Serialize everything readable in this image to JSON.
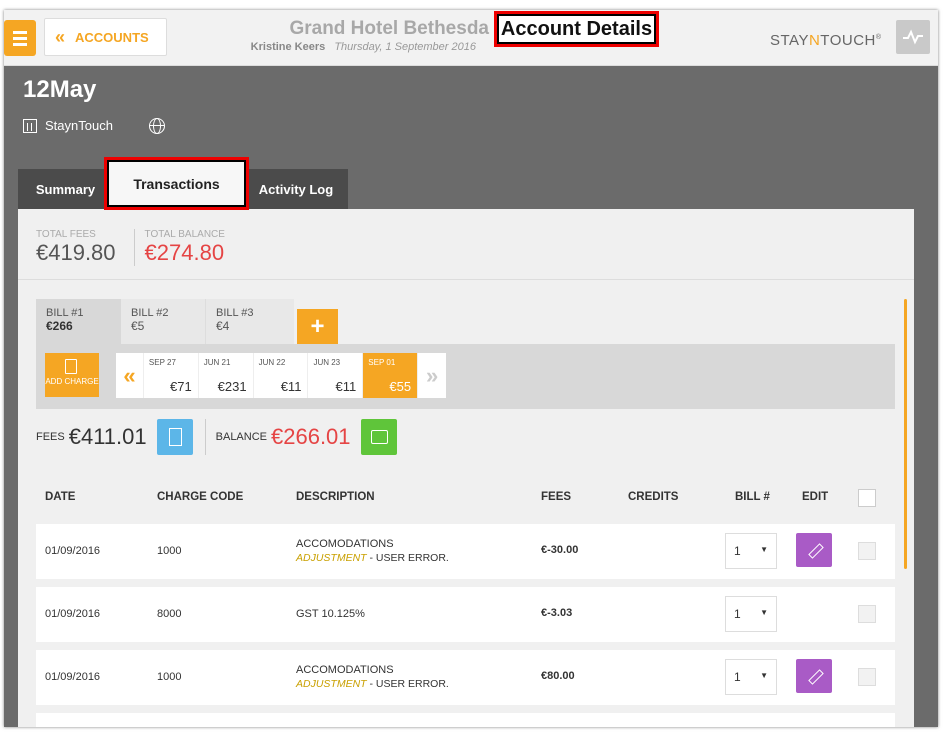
{
  "header": {
    "back_label": "ACCOUNTS",
    "hotel_name": "Grand Hotel Bethesda",
    "user_name": "Kristine Keers",
    "date": "Thursday, 1 September 2016",
    "page_title": "Account Details",
    "logo_left": "STAY",
    "logo_n": "N",
    "logo_right": "TOUCH",
    "logo_mark": "®"
  },
  "account": {
    "name": "12May",
    "company": "StaynTouch"
  },
  "tabs": [
    {
      "label": "Summary"
    },
    {
      "label": "Transactions"
    },
    {
      "label": "Activity Log"
    }
  ],
  "totals": {
    "fees_label": "TOTAL FEES",
    "fees_value": "€419.80",
    "balance_label": "TOTAL BALANCE",
    "balance_value": "€274.80"
  },
  "bills": [
    {
      "label": "BILL #1",
      "amount": "€266"
    },
    {
      "label": "BILL #2",
      "amount": "€5"
    },
    {
      "label": "BILL #3",
      "amount": "€4"
    }
  ],
  "add_bill_symbol": "+",
  "add_charge_label": "ADD CHARGE",
  "date_nav": {
    "prev": "«",
    "next": "»"
  },
  "dates": [
    {
      "label": "SEP 27",
      "amount": "€71"
    },
    {
      "label": "JUN 21",
      "amount": "€231"
    },
    {
      "label": "JUN 22",
      "amount": "€11"
    },
    {
      "label": "JUN 23",
      "amount": "€11"
    },
    {
      "label": "SEP 01",
      "amount": "€55"
    }
  ],
  "summary": {
    "fees_label": "FEES",
    "fees_value": "€411.01",
    "balance_label": "BALANCE",
    "balance_value": "€266.01"
  },
  "table": {
    "headers": [
      "DATE",
      "CHARGE CODE",
      "DESCRIPTION",
      "FEES",
      "CREDITS",
      "BILL #",
      "EDIT"
    ],
    "rows": [
      {
        "date": "01/09/2016",
        "code": "1000",
        "desc": "ACCOMODATIONS",
        "adj": "ADJUSTMENT",
        "reason": " - USER ERROR.",
        "fees": "€-30.00",
        "bill": "1"
      },
      {
        "date": "01/09/2016",
        "code": "8000",
        "desc": "GST 10.125%",
        "adj": "",
        "reason": "",
        "fees": "€-3.03",
        "bill": "1"
      },
      {
        "date": "01/09/2016",
        "code": "1000",
        "desc": "ACCOMODATIONS",
        "adj": "ADJUSTMENT",
        "reason": " - USER ERROR.",
        "fees": "€80.00",
        "bill": "1"
      }
    ]
  },
  "colors": {
    "accent": "#f5a623",
    "negative": "#e54444",
    "edit": "#a95bc6",
    "highlight": "#ee0000"
  }
}
